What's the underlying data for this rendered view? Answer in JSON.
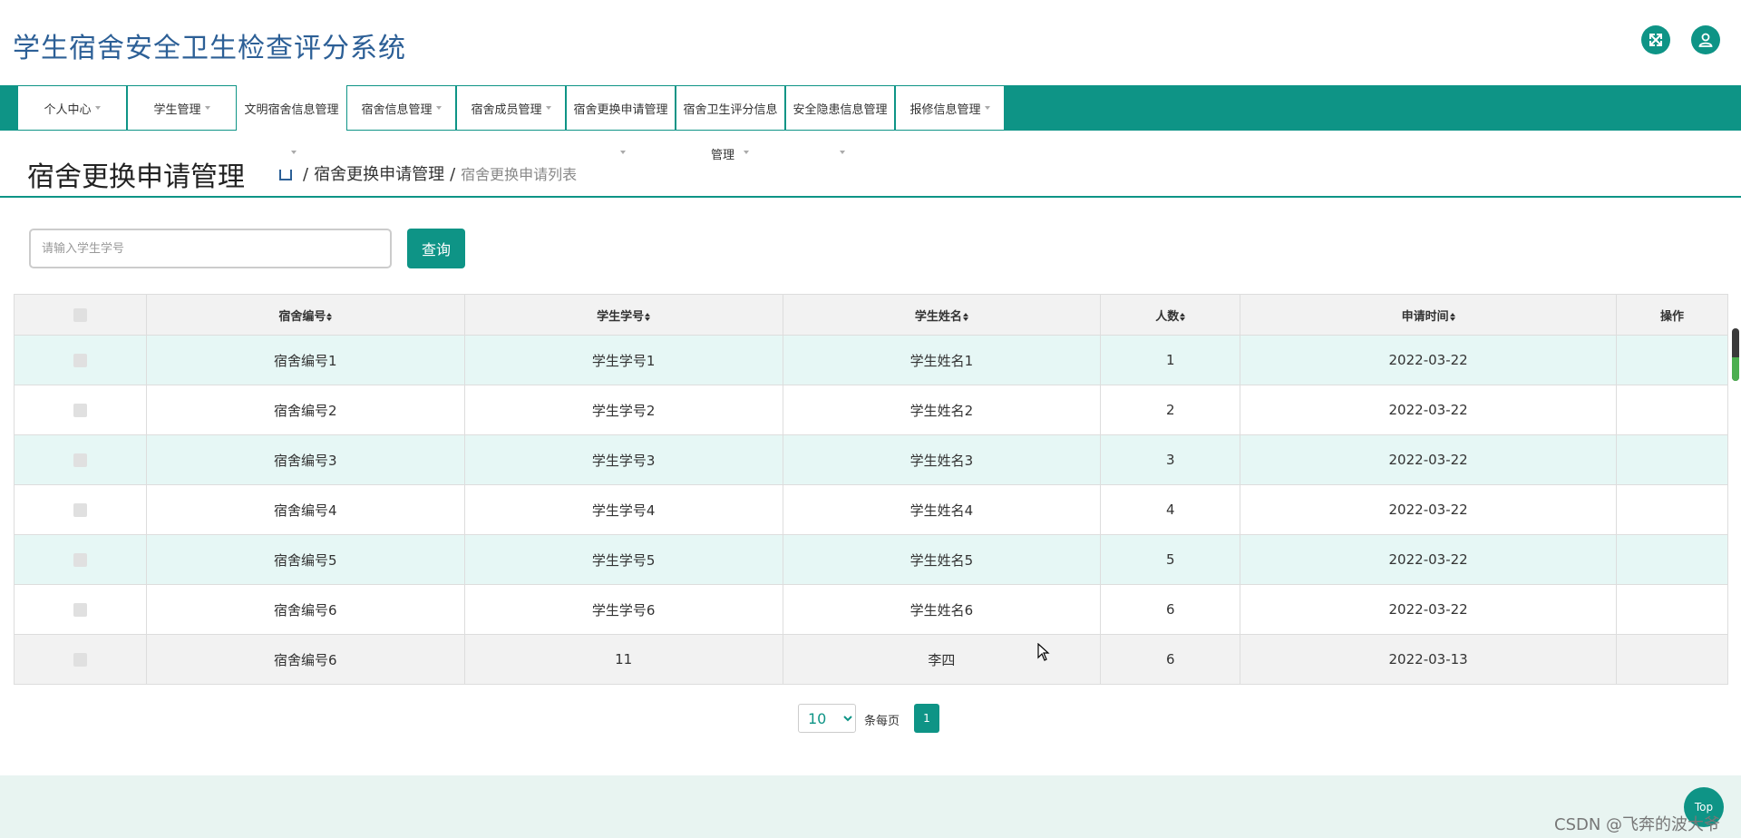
{
  "header": {
    "title": "学生宿舍安全卫生检查评分系统",
    "fullscreen_icon": "fullscreen-icon",
    "user_icon": "user-icon",
    "accent_color": "#0e9486"
  },
  "nav": {
    "items": [
      {
        "label": "个人中心"
      },
      {
        "label": "学生管理"
      },
      {
        "label": "文明宿舍信息管理"
      },
      {
        "label": "宿舍信息管理"
      },
      {
        "label": "宿舍成员管理"
      },
      {
        "label": "宿舍更换申请管理"
      },
      {
        "label": "宿舍卫生评分信息"
      },
      {
        "label": "安全隐患信息管理"
      },
      {
        "label": "报修信息管理"
      }
    ],
    "wrapped_text": "管理"
  },
  "page": {
    "title": "宿舍更换申请管理",
    "breadcrumb_parent": "宿舍更换申请管理",
    "breadcrumb_current": "宿舍更换申请列表"
  },
  "search": {
    "placeholder": "请输入学生学号",
    "value": "",
    "button_label": "查询"
  },
  "table": {
    "columns": [
      "宿舍编号",
      "学生学号",
      "学生姓名",
      "人数",
      "申请时间",
      "操作"
    ],
    "rows": [
      [
        "宿舍编号1",
        "学生学号1",
        "学生姓名1",
        "1",
        "2022-03-22",
        ""
      ],
      [
        "宿舍编号2",
        "学生学号2",
        "学生姓名2",
        "2",
        "2022-03-22",
        ""
      ],
      [
        "宿舍编号3",
        "学生学号3",
        "学生姓名3",
        "3",
        "2022-03-22",
        ""
      ],
      [
        "宿舍编号4",
        "学生学号4",
        "学生姓名4",
        "4",
        "2022-03-22",
        ""
      ],
      [
        "宿舍编号5",
        "学生学号5",
        "学生姓名5",
        "5",
        "2022-03-22",
        ""
      ],
      [
        "宿舍编号6",
        "学生学号6",
        "学生姓名6",
        "6",
        "2022-03-22",
        ""
      ],
      [
        "宿舍编号6",
        "11",
        "李四",
        "6",
        "2022-03-13",
        ""
      ]
    ]
  },
  "pagination": {
    "page_size": "10",
    "per_page_label": "条每页",
    "current_page": "1"
  },
  "footer": {
    "top_label": "Top",
    "watermark": "CSDN @飞奔的波大爷"
  }
}
